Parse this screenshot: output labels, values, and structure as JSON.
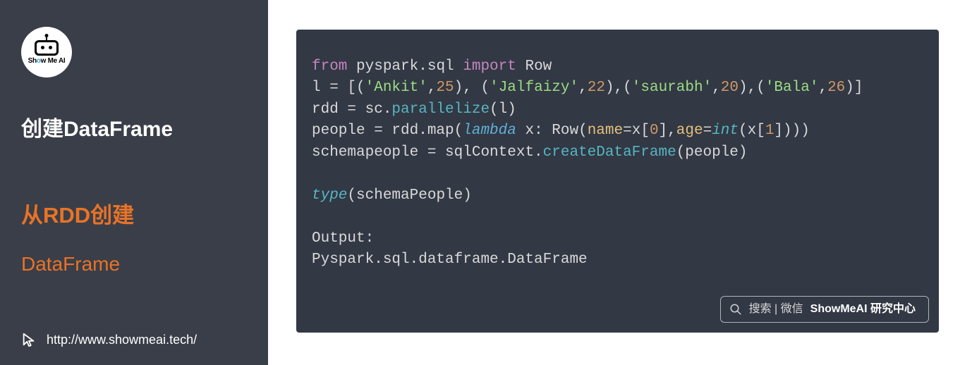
{
  "sidebar": {
    "logo_text_pre": "Sh",
    "logo_text_o": "o",
    "logo_text_post": "w Me AI",
    "headline": "创建DataFrame",
    "subtitle_line1": "从RDD创建",
    "subtitle_line2": "DataFrame",
    "footer_url": "http://www.showmeai.tech/"
  },
  "code": {
    "l1_from": "from",
    "l1_mod": " pyspark.sql ",
    "l1_import": "import",
    "l1_row": " Row",
    "l2_pre": "l = [(",
    "l2_s1": "'Ankit'",
    "l2_c1": ",",
    "l2_n1": "25",
    "l2_m1": "), (",
    "l2_s2": "'Jalfaizy'",
    "l2_c2": ",",
    "l2_n2": "22",
    "l2_m2": "),(",
    "l2_s3": "'saurabh'",
    "l2_c3": ",",
    "l2_n3": "20",
    "l2_m3": "),(",
    "l2_s4": "'Bala'",
    "l2_c4": ",",
    "l2_n4": "26",
    "l2_end": ")]",
    "l3_pre": "rdd = sc.",
    "l3_fn": "parallelize",
    "l3_post": "(l)",
    "l4_pre": "people = rdd.map(",
    "l4_lambda": "lambda",
    "l4_mid1": " x: Row(",
    "l4_name": "name",
    "l4_eq1": "=x[",
    "l4_i0": "0",
    "l4_mid2": "],",
    "l4_age": "age",
    "l4_eq2": "=",
    "l4_int": "int",
    "l4_px": "(x[",
    "l4_i1": "1",
    "l4_end": "])))",
    "l5_pre": "schemapeople = sqlContext.",
    "l5_fn": "createDataFrame",
    "l5_post": "(people)",
    "l7_type": "type",
    "l7_post": "(schemaPeople)",
    "l9": "Output:",
    "l10": "Pyspark.sql.dataframe.DataFrame"
  },
  "search": {
    "prefix": "搜索 | 微信",
    "strong": "ShowMeAI 研究中心"
  },
  "watermark": {
    "c1": "S",
    "l1": "how",
    "c2": "M",
    "l2": "e",
    "c3": "AI"
  }
}
